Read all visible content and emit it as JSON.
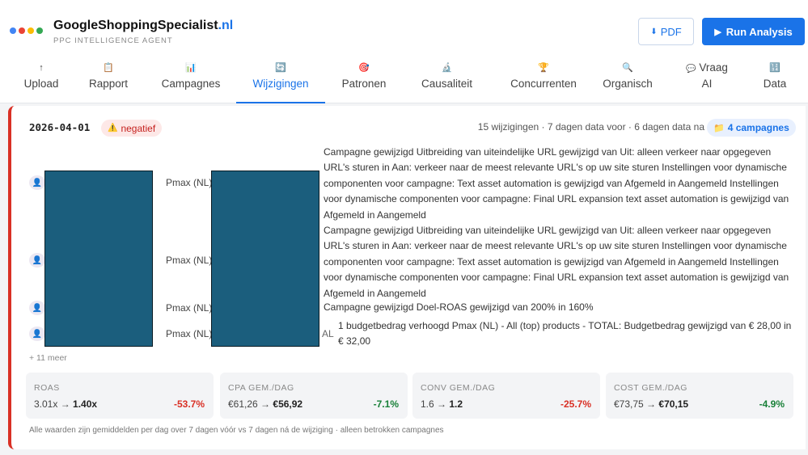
{
  "brand": {
    "name": "GoogleShoppingSpecialist",
    "tld": ".nl",
    "subtitle": "PPC INTELLIGENCE AGENT",
    "dot_colors": [
      "#4285f4",
      "#ea4335",
      "#fbbc05",
      "#34a853"
    ]
  },
  "toolbar": {
    "pdf_icon": "⬇",
    "pdf_label": "PDF",
    "run_icon": "▶",
    "run_label": "Run Analysis"
  },
  "tabs": [
    {
      "icon": "↑",
      "label": "Upload"
    },
    {
      "icon": "📋",
      "label": "Rapport"
    },
    {
      "icon": "📊",
      "label": "Campagnes"
    },
    {
      "icon": "🔄",
      "label": "Wijzigingen",
      "active": true
    },
    {
      "icon": "🎯",
      "label": "Patronen"
    },
    {
      "icon": "🔬",
      "label": "Causaliteit"
    },
    {
      "icon": "🏆",
      "label": "Concurrenten"
    },
    {
      "icon": "🔍",
      "label": "Organisch"
    },
    {
      "icon": "💬",
      "label": "Vraag",
      "label2": "AI"
    },
    {
      "icon": "🔢",
      "label": "Data"
    }
  ],
  "event": {
    "date": "2026-04-01",
    "status_icon": "⚠️",
    "status": "negatief",
    "summary": "15 wijzigingen · 7 dagen data voor · 6 dagen data na",
    "campaigns_icon": "📁",
    "campaigns": "4 campagnes",
    "changes": [
      {
        "user_icon": "👤",
        "campaign": "Pmax (NL)",
        "prefix": "",
        "description": "Campagne gewijzigd Uitbreiding van uiteindelijke URL gewijzigd van Uit: alleen verkeer naar opgegeven URL's sturen in Aan: verkeer naar de meest relevante URL's op uw site sturen Instellingen voor dynamische componenten voor campagne: Text asset automation is gewijzigd van Afgemeld in Aangemeld Instellingen voor dynamische componenten voor campagne: Final URL expansion text asset automation is gewijzigd van Afgemeld in Aangemeld"
      },
      {
        "user_icon": "👤",
        "campaign": "Pmax (NL)",
        "prefix": "",
        "description": "Campagne gewijzigd Uitbreiding van uiteindelijke URL gewijzigd van Uit: alleen verkeer naar opgegeven URL's sturen in Aan: verkeer naar de meest relevante URL's op uw site sturen Instellingen voor dynamische componenten voor campagne: Text asset automation is gewijzigd van Afgemeld in Aangemeld Instellingen voor dynamische componenten voor campagne: Final URL expansion text asset automation is gewijzigd van Afgemeld in Aangemeld"
      },
      {
        "user_icon": "👤",
        "campaign": "Pmax (NL)",
        "prefix": "",
        "description": "Campagne gewijzigd Doel-ROAS gewijzigd van 200% in 160%"
      },
      {
        "user_icon": "👤",
        "campaign": "Pmax (NL)",
        "prefix": "AL",
        "description": "1 budgetbedrag verhoogd Pmax (NL) - All (top) products - TOTAL: Budgetbedrag gewijzigd van € 28,00 in € 32,00"
      }
    ],
    "more": "+ 11 meer",
    "metrics": [
      {
        "label": "ROAS",
        "before": "3.01x",
        "arrow": "→",
        "after": "1.40x",
        "change": "-53.7%",
        "color": "#d93025"
      },
      {
        "label": "CPA GEM./DAG",
        "before": "€61,26",
        "arrow": "→",
        "after": "€56,92",
        "change": "-7.1%",
        "color": "#188038"
      },
      {
        "label": "CONV GEM./DAG",
        "before": "1.6",
        "arrow": "→",
        "after": "1.2",
        "change": "-25.7%",
        "color": "#d93025"
      },
      {
        "label": "COST GEM./DAG",
        "before": "€73,75",
        "arrow": "→",
        "after": "€70,15",
        "change": "-4.9%",
        "color": "#188038"
      }
    ],
    "footnote": "Alle waarden zijn gemiddelden per dag over 7 dagen vóór vs 7 dagen ná de wijziging · alleen betrokken campagnes"
  }
}
